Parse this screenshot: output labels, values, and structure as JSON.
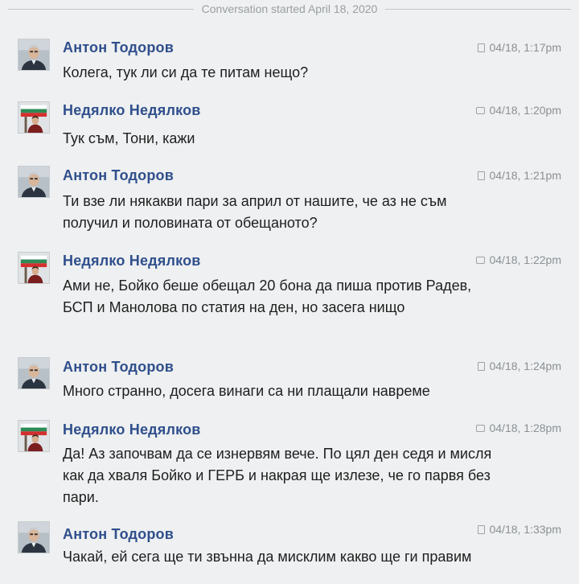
{
  "conversation_header": "Conversation started April 18, 2020",
  "messages": [
    {
      "sender": "Антон Тодоров",
      "time": "04/18, 1:17pm",
      "text": "Колега, тук ли си да те питам нещо?",
      "avatar": "man-gray-hair-avatar",
      "status_icon": "document-icon"
    },
    {
      "sender": "Недялко Недялков",
      "time": "04/18, 1:20pm",
      "text": "Тук съм, Тони, кажи",
      "avatar": "man-with-flag-avatar",
      "status_icon": "chat-icon"
    },
    {
      "sender": "Антон Тодоров",
      "time": "04/18, 1:21pm",
      "text": "Ти взе ли някакви пари за април от нашите, че аз не съм получил и половината от обещаното?",
      "avatar": "man-gray-hair-avatar",
      "status_icon": "document-icon"
    },
    {
      "sender": "Недялко Недялков",
      "time": "04/18, 1:22pm",
      "text": "Ами не, Бойко беше обещал 20 бона да пиша против Радев, БСП и Манолова по статия на ден, но засега нищо",
      "avatar": "man-with-flag-avatar",
      "status_icon": "chat-icon"
    },
    {
      "sender": "Антон Тодоров",
      "time": "04/18, 1:24pm",
      "text": "Много странно, досега винаги са ни плащали навреме",
      "avatar": "man-gray-hair-avatar",
      "status_icon": "document-icon"
    },
    {
      "sender": "Недялко Недялков",
      "time": "04/18, 1:28pm",
      "text": "Да! Аз започвам да се изнервям вече. По цял ден седя и мисля как да хваля Бойко и ГЕРБ и накрая ще излезе, че го парвя без пари.",
      "avatar": "man-with-flag-avatar",
      "status_icon": "chat-icon"
    },
    {
      "sender": "Антон Тодоров",
      "time": "04/18, 1:33pm",
      "text": "Чакай, ей сега ще ти звънна да мисклим какво ще ги правим",
      "avatar": "man-gray-hair-avatar",
      "status_icon": "document-icon"
    }
  ]
}
